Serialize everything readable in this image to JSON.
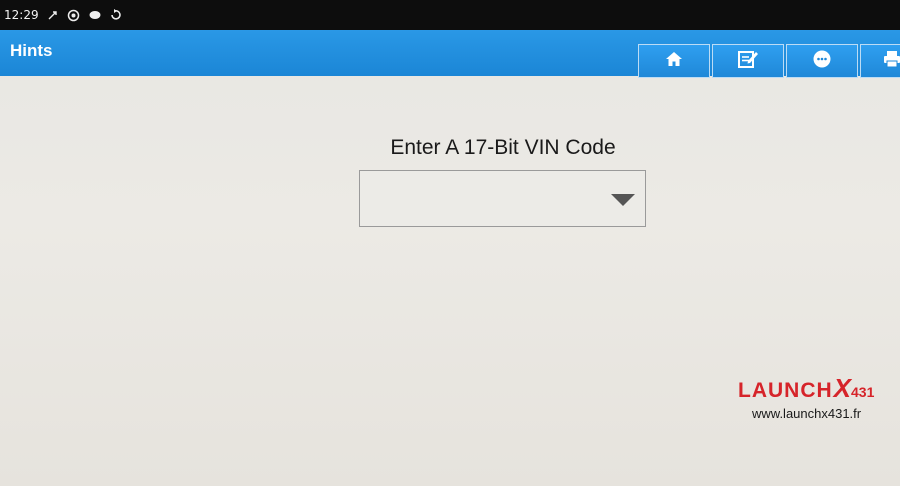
{
  "status_bar": {
    "time": "12:29",
    "icons": [
      "usb-icon",
      "sync-icon",
      "cloud-icon",
      "refresh-icon"
    ]
  },
  "title_bar": {
    "title": "Hints",
    "buttons": [
      {
        "name": "home",
        "icon": "home-icon"
      },
      {
        "name": "report",
        "icon": "edit-report-icon"
      },
      {
        "name": "feedback",
        "icon": "chat-icon"
      },
      {
        "name": "print",
        "icon": "print-icon"
      }
    ],
    "color": "#1f8ddc"
  },
  "main": {
    "prompt": "Enter A 17-Bit VIN Code",
    "vin_select": {
      "value": ""
    }
  },
  "watermark": {
    "brand": "LAUNCH",
    "brand_x": "X",
    "brand_num": "431",
    "url": "www.launchx431.fr",
    "color": "#d6242a"
  }
}
